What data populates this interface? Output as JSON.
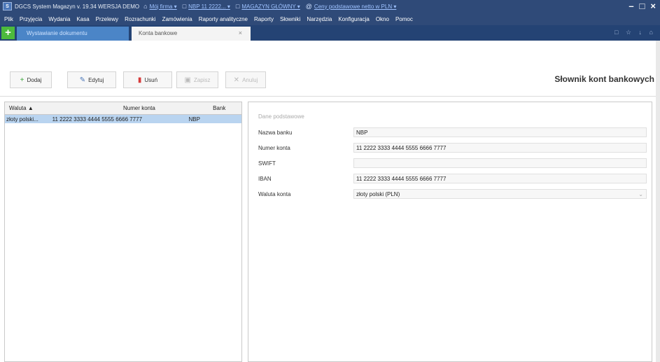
{
  "title_bar": {
    "logo": "S",
    "app_title": "DGCS System Magazyn v. 19.34  WERSJA DEMO",
    "links": [
      {
        "icon": "⌂",
        "label": "Mój firma ▾"
      },
      {
        "icon": "□",
        "label": "NBP 11 2222... ▾"
      },
      {
        "icon": "□",
        "label": "MAGAZYN GŁÓWNY ▾"
      },
      {
        "icon": "@",
        "label": "Ceny podstawowe netto w PLN ▾"
      }
    ],
    "controls": [
      "–",
      "□",
      "×"
    ]
  },
  "menu": [
    "Plik",
    "Przyjęcia",
    "Wydania",
    "Kasa",
    "Przelewy",
    "Rozrachunki",
    "Zamówienia",
    "Raporty analityczne",
    "Raporty",
    "Słowniki",
    "Narzędzia",
    "Konfiguracja",
    "Okno",
    "Pomoc"
  ],
  "tabs": {
    "add": "+",
    "items": [
      {
        "label": "Wystawianie dokumentu"
      },
      {
        "label": "Konta bankowe",
        "close": "×"
      }
    ],
    "right_icons": "□ ☆ ↓ ⌂"
  },
  "toolbar": {
    "add_label": "Dodaj",
    "edit_label": "Edytuj",
    "delete_label": "Usuń",
    "save_label": "Zapisz",
    "cancel_label": "Anuluj",
    "page_title": "Słownik kont bankowych"
  },
  "list": {
    "columns": [
      "Waluta ▲",
      "Numer konta",
      "Bank"
    ],
    "rows": [
      {
        "currency": "złoty polski...",
        "account": "11 2222 3333 4444 5555 6666 7777",
        "bank": "NBP"
      }
    ]
  },
  "form": {
    "section": "Dane podstawowe",
    "fields": [
      {
        "label": "Nazwa banku",
        "value": "NBP"
      },
      {
        "label": "Numer konta",
        "value": "11 2222 3333 4444 5555 6666 7777"
      },
      {
        "label": "SWIFT",
        "value": ""
      },
      {
        "label": "IBAN",
        "value": "11 2222 3333 4444 5555 6666 7777"
      },
      {
        "label": "Waluta konta",
        "value": "złoty polski (PLN)"
      }
    ]
  }
}
